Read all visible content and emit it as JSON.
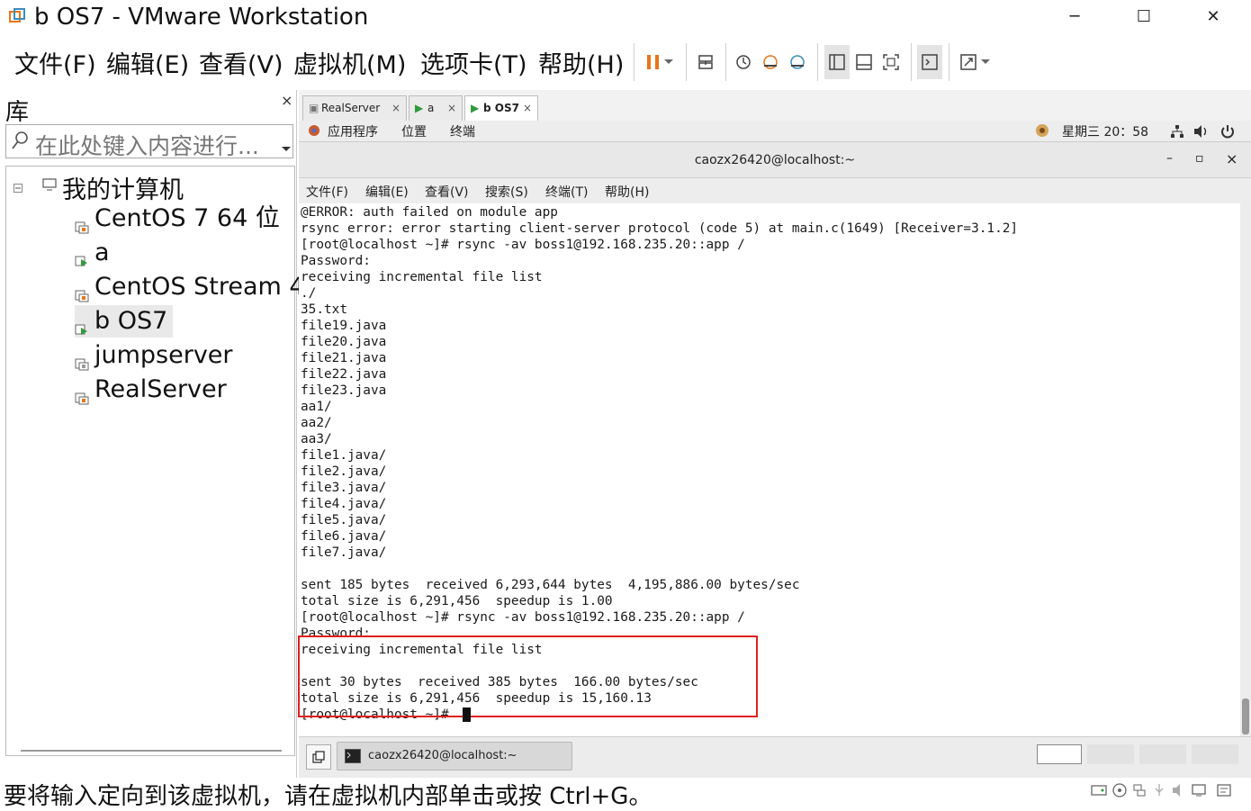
{
  "window": {
    "title": "b OS7 - VMware Workstation",
    "controls": [
      "─",
      "☐",
      "✕"
    ]
  },
  "menu": {
    "items": [
      "文件(F)",
      "编辑(E)",
      "查看(V)",
      "虚拟机(M)",
      "选项卡(T)",
      "帮助(H)"
    ]
  },
  "toolbar": {
    "icons": [
      "pause-icon",
      "dropdown-icon",
      "send-ctrl-alt-del-icon",
      "snapshot-icon",
      "revert-snapshot-icon",
      "snapshot-manager-icon",
      "library-view-icon",
      "thumbnail-view-icon",
      "fullscreen-icon",
      "console-view-icon",
      "stretch-icon"
    ],
    "accent": "#e8751a"
  },
  "library": {
    "title": "库",
    "close": "×",
    "search_placeholder": "在此处键入内容进行...",
    "root": "我的计算机",
    "vms": [
      "CentOS 7 64 位",
      "a",
      "CentOS Stream 4",
      "b OS7",
      "jumpserver",
      "RealServer"
    ],
    "selected": "b OS7"
  },
  "tabs": [
    {
      "label": "RealServer",
      "close": "×"
    },
    {
      "label": "a",
      "close": "×"
    },
    {
      "label": "b OS7",
      "close": "×"
    }
  ],
  "gnome": {
    "apps": "应用程序",
    "places": "位置",
    "terminal": "终端",
    "clock": "星期三 20：58"
  },
  "terminal": {
    "title": "caozx26420@localhost:~",
    "controls": [
      "–",
      "▫",
      "×"
    ],
    "menu": [
      "文件(F)",
      "编辑(E)",
      "查看(V)",
      "搜索(S)",
      "终端(T)",
      "帮助(H)"
    ],
    "lines": [
      "@ERROR: auth failed on module app",
      "rsync error: error starting client-server protocol (code 5) at main.c(1649) [Receiver=3.1.2]",
      "[root@localhost ~]# rsync -av boss1@192.168.235.20::app /",
      "Password:",
      "receiving incremental file list",
      "./",
      "35.txt",
      "file19.java",
      "file20.java",
      "file21.java",
      "file22.java",
      "file23.java",
      "aa1/",
      "aa2/",
      "aa3/",
      "file1.java/",
      "file2.java/",
      "file3.java/",
      "file4.java/",
      "file5.java/",
      "file6.java/",
      "file7.java/",
      "",
      "sent 185 bytes  received 6,293,644 bytes  4,195,886.00 bytes/sec",
      "total size is 6,291,456  speedup is 1.00",
      "[root@localhost ~]# rsync -av boss1@192.168.235.20::app /",
      "Password:",
      "receiving incremental file list",
      "",
      "sent 30 bytes  received 385 bytes  166.00 bytes/sec",
      "total size is 6,291,456  speedup is 15,160.13",
      "[root@localhost ~]# "
    ]
  },
  "taskbar": {
    "task_label": "caozx26420@localhost:~"
  },
  "status": {
    "text": "要将输入定向到该虚拟机，请在虚拟机内部单击或按 Ctrl+G。"
  }
}
